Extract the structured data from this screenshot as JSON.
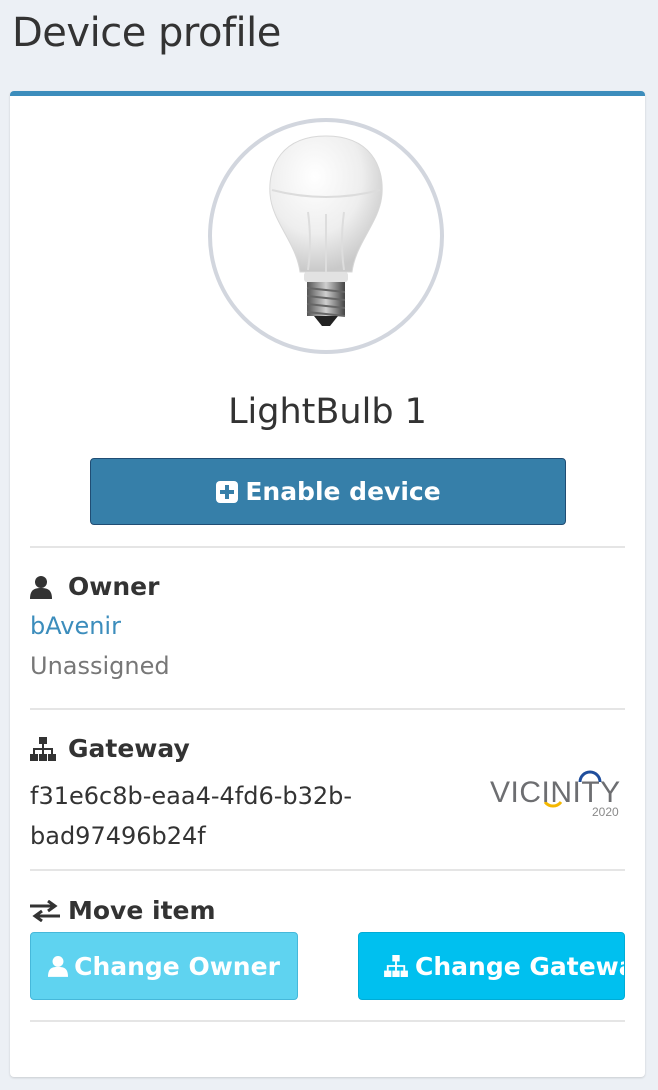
{
  "page": {
    "title": "Device profile"
  },
  "device": {
    "name": "LightBulb 1",
    "image": "light-bulb"
  },
  "actions": {
    "enable_label": "Enable device",
    "enable_icon": "plus-square-icon"
  },
  "owner": {
    "label": "Owner",
    "icon": "user-icon",
    "name": "bAvenir",
    "status": "Unassigned"
  },
  "gateway": {
    "label": "Gateway",
    "icon": "sitemap-icon",
    "id": "f31e6c8b-eaa4-4fd6-b32b-bad97496b24f",
    "logo_text": "VICINITY",
    "logo_year": "2020"
  },
  "move": {
    "label": "Move item",
    "icon": "exchange-icon",
    "change_owner_label": "Change Owner",
    "change_gateway_label": "Change Gateway"
  },
  "colors": {
    "primary": "#3c8dbc",
    "info": "#00c0ef",
    "link": "#3c8dbc"
  }
}
